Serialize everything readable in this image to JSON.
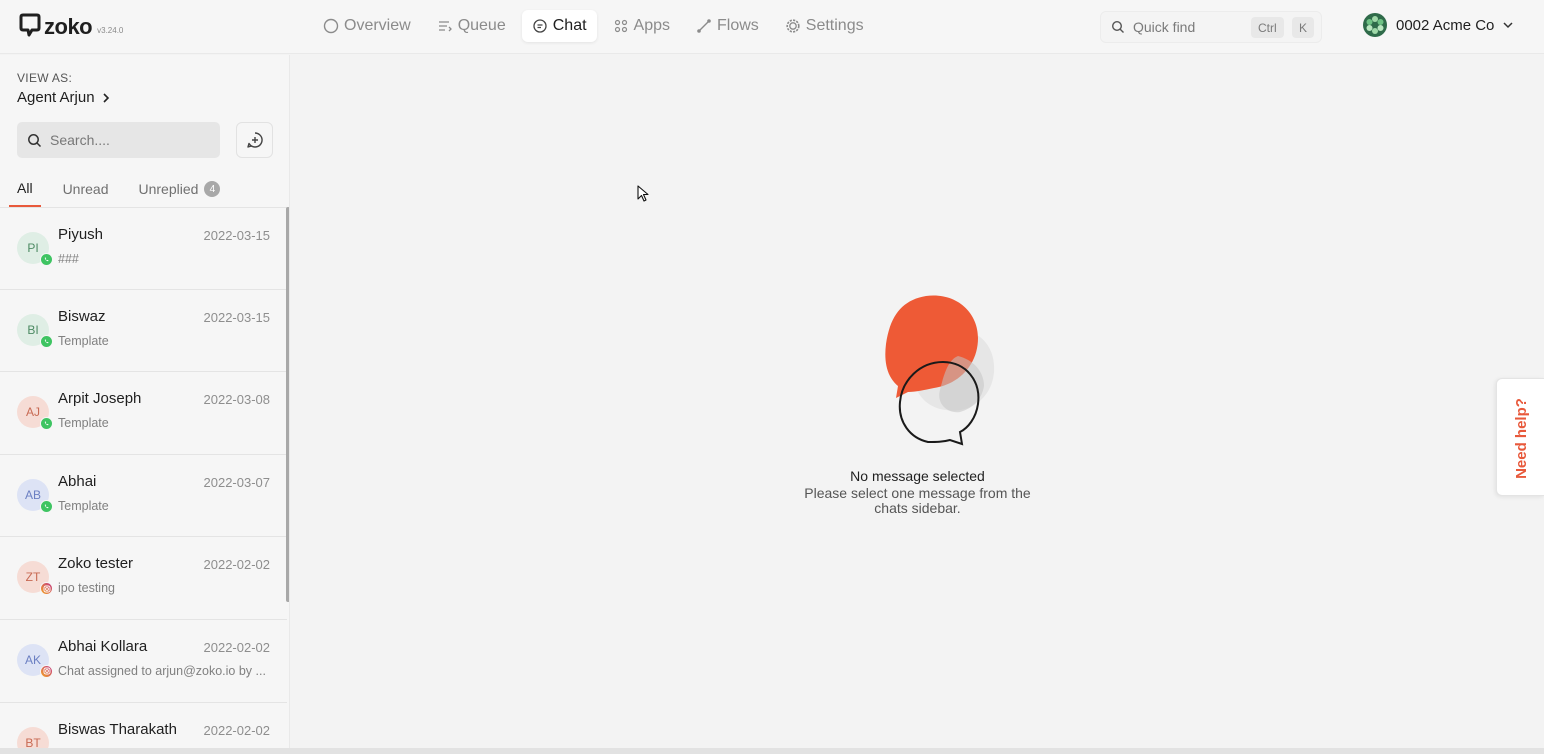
{
  "app": {
    "logo_text": "zoko",
    "version": "v3.24.0"
  },
  "nav": {
    "items": [
      {
        "label": "Overview",
        "icon": "circle-icon"
      },
      {
        "label": "Queue",
        "icon": "queue-icon"
      },
      {
        "label": "Chat",
        "icon": "chat-icon",
        "active": true
      },
      {
        "label": "Apps",
        "icon": "apps-grid-icon"
      },
      {
        "label": "Flows",
        "icon": "flows-icon"
      },
      {
        "label": "Settings",
        "icon": "gear-icon"
      }
    ]
  },
  "quickfind": {
    "placeholder": "Quick find",
    "shortcut_key1": "Ctrl",
    "shortcut_key2": "K"
  },
  "account": {
    "name": "0002 Acme Co"
  },
  "sidebar": {
    "view_as_label": "VIEW AS:",
    "view_as_name": "Agent Arjun",
    "search_placeholder": "Search....",
    "tabs": [
      {
        "label": "All",
        "active": true
      },
      {
        "label": "Unread"
      },
      {
        "label": "Unreplied",
        "badge": "4"
      }
    ],
    "chats": [
      {
        "initials": "PI",
        "name": "Piyush",
        "date": "2022-03-15",
        "preview": "###",
        "channel": "whatsapp",
        "avatar_bg": "#dfeee5",
        "avatar_fg": "#4c8a63"
      },
      {
        "initials": "BI",
        "name": "Biswaz",
        "date": "2022-03-15",
        "preview": "Template",
        "channel": "whatsapp",
        "avatar_bg": "#dfeee5",
        "avatar_fg": "#4c8a63"
      },
      {
        "initials": "AJ",
        "name": "Arpit Joseph",
        "date": "2022-03-08",
        "preview": "Template",
        "channel": "whatsapp",
        "avatar_bg": "#f6dcd5",
        "avatar_fg": "#c86a53"
      },
      {
        "initials": "AB",
        "name": "Abhai",
        "date": "2022-03-07",
        "preview": "Template",
        "channel": "whatsapp",
        "avatar_bg": "#dde3f5",
        "avatar_fg": "#6b7fc2"
      },
      {
        "initials": "ZT",
        "name": "Zoko tester",
        "date": "2022-02-02",
        "preview": "ipo testing",
        "channel": "instagram",
        "avatar_bg": "#f6dcd5",
        "avatar_fg": "#c86a53"
      },
      {
        "initials": "AK",
        "name": "Abhai Kollara",
        "date": "2022-02-02",
        "preview": "Chat assigned to arjun@zoko.io by ...",
        "channel": "instagram",
        "avatar_bg": "#dde3f5",
        "avatar_fg": "#6b7fc2"
      },
      {
        "initials": "BT",
        "name": "Biswas Tharakath",
        "date": "2022-02-02",
        "preview": "",
        "channel": "instagram",
        "avatar_bg": "#f6dcd5",
        "avatar_fg": "#c86a53"
      }
    ]
  },
  "empty_state": {
    "title": "No message selected",
    "subtitle": "Please select one message from the chats sidebar."
  },
  "help": {
    "label": "Need help?"
  },
  "colors": {
    "accent": "#e8593b",
    "whatsapp": "#3ec462",
    "instagram_gradient_start": "#f5a623",
    "instagram_gradient_end": "#c13584"
  }
}
